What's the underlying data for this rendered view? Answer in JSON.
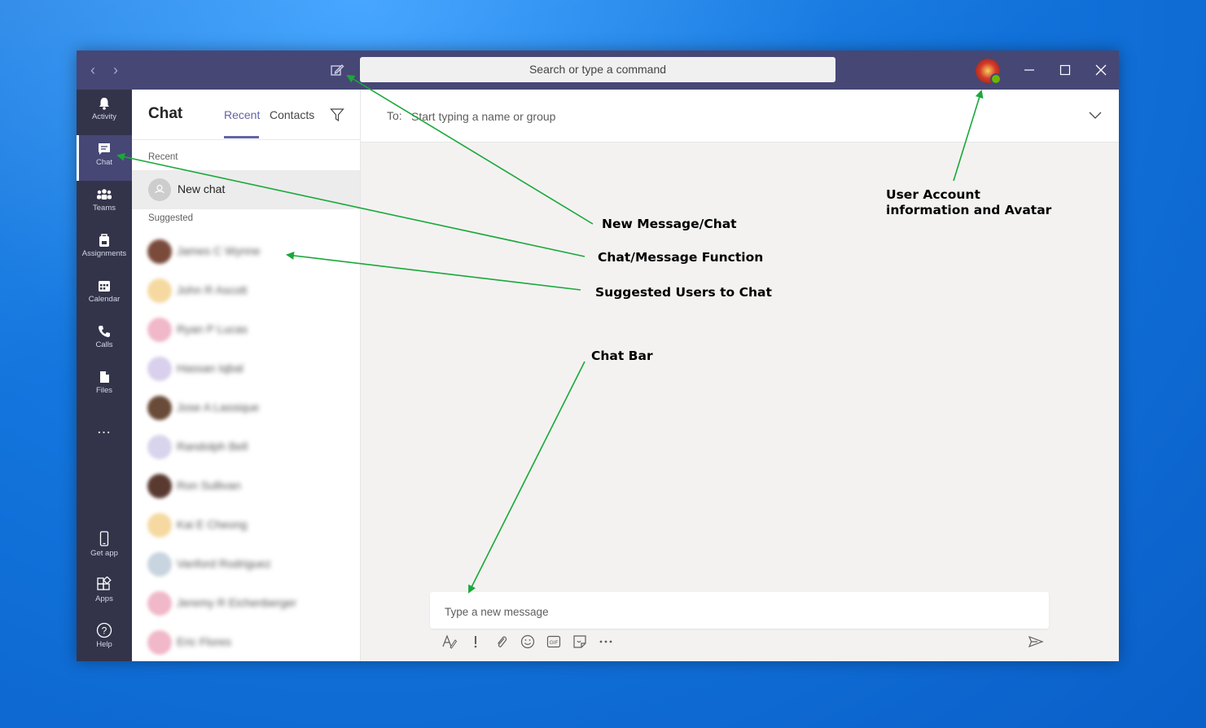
{
  "titlebar": {
    "back": "‹",
    "forward": "›",
    "search_placeholder": "Search or type a command"
  },
  "rail": [
    {
      "label": "Activity",
      "icon": "bell-icon"
    },
    {
      "label": "Chat",
      "icon": "chat-icon",
      "active": true
    },
    {
      "label": "Teams",
      "icon": "teams-icon"
    },
    {
      "label": "Assignments",
      "icon": "backpack-icon"
    },
    {
      "label": "Calendar",
      "icon": "calendar-icon"
    },
    {
      "label": "Calls",
      "icon": "phone-icon"
    },
    {
      "label": "Files",
      "icon": "file-icon"
    },
    {
      "label": "…",
      "icon": "more-icon"
    },
    {
      "label": "Get app",
      "icon": "mobile-icon"
    },
    {
      "label": "Apps",
      "icon": "apps-icon"
    },
    {
      "label": "Help",
      "icon": "help-icon"
    }
  ],
  "chatpane": {
    "title": "Chat",
    "tabs": [
      "Recent",
      "Contacts"
    ],
    "recent_label": "Recent",
    "new_chat": "New chat",
    "suggested_label": "Suggested",
    "suggested": [
      {
        "name": "James C Wynne",
        "color": "#7a4a3a"
      },
      {
        "name": "John R Ascott",
        "color": "#f5d9a0"
      },
      {
        "name": "Ryan P Lucas",
        "color": "#f0b8c8"
      },
      {
        "name": "Hassan Iqbal",
        "color": "#d8d0ec"
      },
      {
        "name": "Jose A Lassique",
        "color": "#6a4a38"
      },
      {
        "name": "Randolph Bell",
        "color": "#d8d4ec"
      },
      {
        "name": "Ron Sullivan",
        "color": "#5a3a30"
      },
      {
        "name": "Kai E Cheong",
        "color": "#f5d9a0"
      },
      {
        "name": "Vanford Rodriguez",
        "color": "#c8d4e0"
      },
      {
        "name": "Jeremy R Eichenberger",
        "color": "#f0b8c8"
      },
      {
        "name": "Eric Flores",
        "color": "#f0b8c8"
      }
    ]
  },
  "main": {
    "to_label": "To:",
    "to_placeholder": "Start typing a name or group",
    "message_placeholder": "Type a new message"
  },
  "annotations": {
    "new_message": "New Message/Chat",
    "chat_function": "Chat/Message Function",
    "suggested_users": "Suggested Users to Chat",
    "chat_bar": "Chat Bar",
    "user_account_1": "User Account",
    "user_account_2": "information and Avatar",
    "arrow_color": "#1aa83a"
  }
}
